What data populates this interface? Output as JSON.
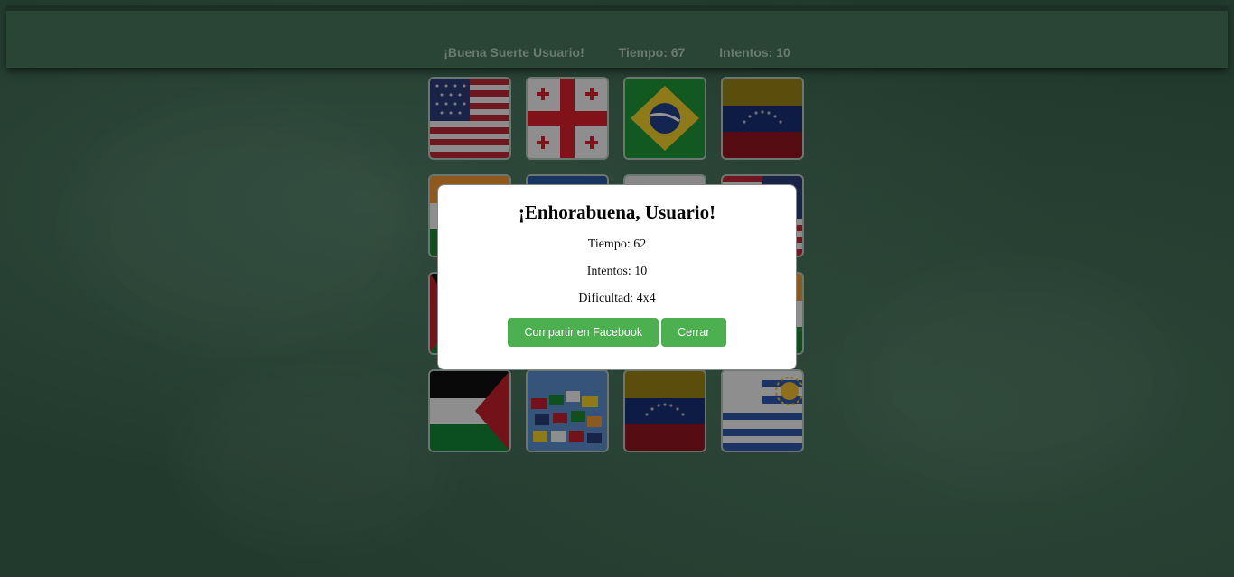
{
  "header": {
    "greeting": "¡Buena Suerte Usuario!",
    "time_label": "Tiempo: 67",
    "attempts_label": "Intentos: 10"
  },
  "board": {
    "cards": [
      {
        "flag": "usa-flag"
      },
      {
        "flag": "georgia-flag"
      },
      {
        "flag": "brazil-flag"
      },
      {
        "flag": "venezuela-flag"
      },
      {
        "flag": "india-flag"
      },
      {
        "flag": "blue-flag"
      },
      {
        "flag": "white-blue-flag"
      },
      {
        "flag": "usa-flag"
      },
      {
        "flag": "palestine-flag"
      },
      {
        "flag": "hidden"
      },
      {
        "flag": "hidden"
      },
      {
        "flag": "india-flag"
      },
      {
        "flag": "palestine-flag"
      },
      {
        "flag": "world-flags"
      },
      {
        "flag": "venezuela-flag"
      },
      {
        "flag": "uruguay-flag"
      }
    ]
  },
  "modal": {
    "title": "¡Enhorabuena, Usuario!",
    "time": "Tiempo: 62",
    "attempts": "Intentos: 10",
    "difficulty": "Dificultad: 4x4",
    "share_button": "Compartir en Facebook",
    "close_button": "Cerrar"
  },
  "colors": {
    "background": "#223a2e",
    "header": "#2a4436",
    "button": "#4caf50"
  }
}
